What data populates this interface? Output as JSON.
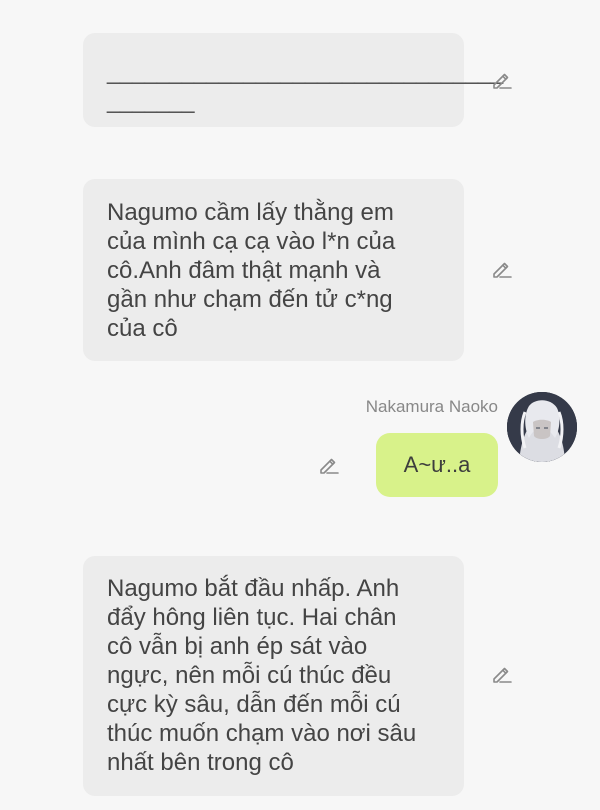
{
  "messages": [
    {
      "text": "________________________________\n_______",
      "icon": "pencil-icon"
    },
    {
      "text": "Nagumo cầm lấy thằng em\ncủa mình cạ cạ vào l*n của\ncô.Anh đâm thật mạnh và\ngần như chạm đến tử c*ng\ncủa cô",
      "icon": "pencil-icon"
    },
    {
      "sender": "Nakamura Naoko",
      "text": "A~ư..a",
      "icon": "pencil-icon",
      "bubble_color": "#d8f28a"
    },
    {
      "text": "Nagumo bắt đầu nhấp. Anh\nđẩy hông liên tục. Hai chân\ncô vẫn bị anh ép sát vào\nngực, nên mỗi cú thúc đều\ncực kỳ sâu, dẫn đến mỗi cú\nthúc muốn chạm vào nơi sâu\nnhất bên trong cô",
      "icon": "pencil-icon"
    }
  ],
  "colors": {
    "background": "#f7f7f7",
    "bubble": "#ececec",
    "reply_bubble": "#d8f28a",
    "text": "#444444",
    "muted": "#888888"
  }
}
